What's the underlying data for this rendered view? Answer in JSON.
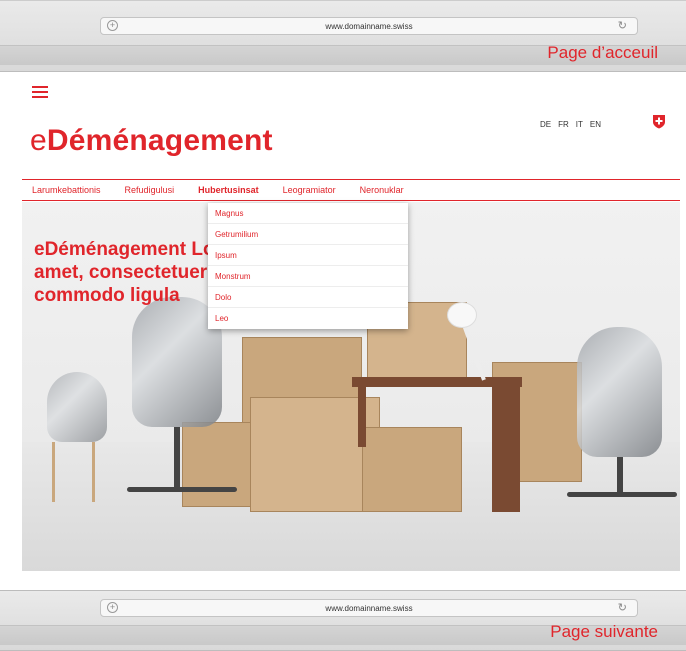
{
  "browser_top": {
    "url": "www.domainname.swiss",
    "page_label": "Page d’acceuil"
  },
  "browser_bottom": {
    "url": "www.domainname.swiss",
    "page_label": "Page suivante"
  },
  "header": {
    "logo_prefix": "e",
    "logo_word": "Déménagement",
    "languages": [
      "DE",
      "FR",
      "IT",
      "EN"
    ]
  },
  "nav": {
    "items": [
      "Larumkebattionis",
      "Refudigulusi",
      "Hubertusinsat",
      "Leogramiator",
      "Neronuklar"
    ],
    "active": "Hubertusinsat"
  },
  "dropdown": {
    "items": [
      "Magnus",
      "Getrumilium",
      "Ipsum",
      "Monstrum",
      "Dolo",
      "Leo"
    ]
  },
  "hero": {
    "line1": "eDéménagement Lorem ipsum dolor",
    "line2": "amet, consectetuer adipiscing. Aenean",
    "line3": "commodo ligula"
  },
  "colors": {
    "accent": "#e0252b"
  }
}
